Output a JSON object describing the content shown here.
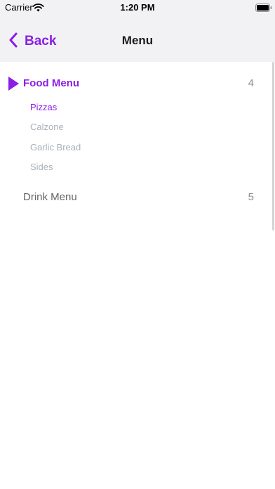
{
  "status_bar": {
    "carrier": "Carrier",
    "time": "1:20 PM",
    "wifi_icon": "wifi-icon",
    "battery_icon": "battery-icon"
  },
  "nav_bar": {
    "back_label": "Back",
    "back_icon": "chevron-left-icon",
    "title": "Menu"
  },
  "colors": {
    "accent": "#8a1ee6",
    "muted": "#a9b0b8",
    "secondary": "#666666",
    "bar_background": "#f2f2f4"
  },
  "menu": {
    "sections": [
      {
        "label": "Food Menu",
        "count": "4",
        "expanded": true,
        "items": [
          {
            "label": "Pizzas",
            "selected": true
          },
          {
            "label": "Calzone",
            "selected": false
          },
          {
            "label": "Garlic Bread",
            "selected": false
          },
          {
            "label": "Sides",
            "selected": false
          }
        ]
      },
      {
        "label": "Drink Menu",
        "count": "5",
        "expanded": false,
        "items": []
      }
    ]
  }
}
